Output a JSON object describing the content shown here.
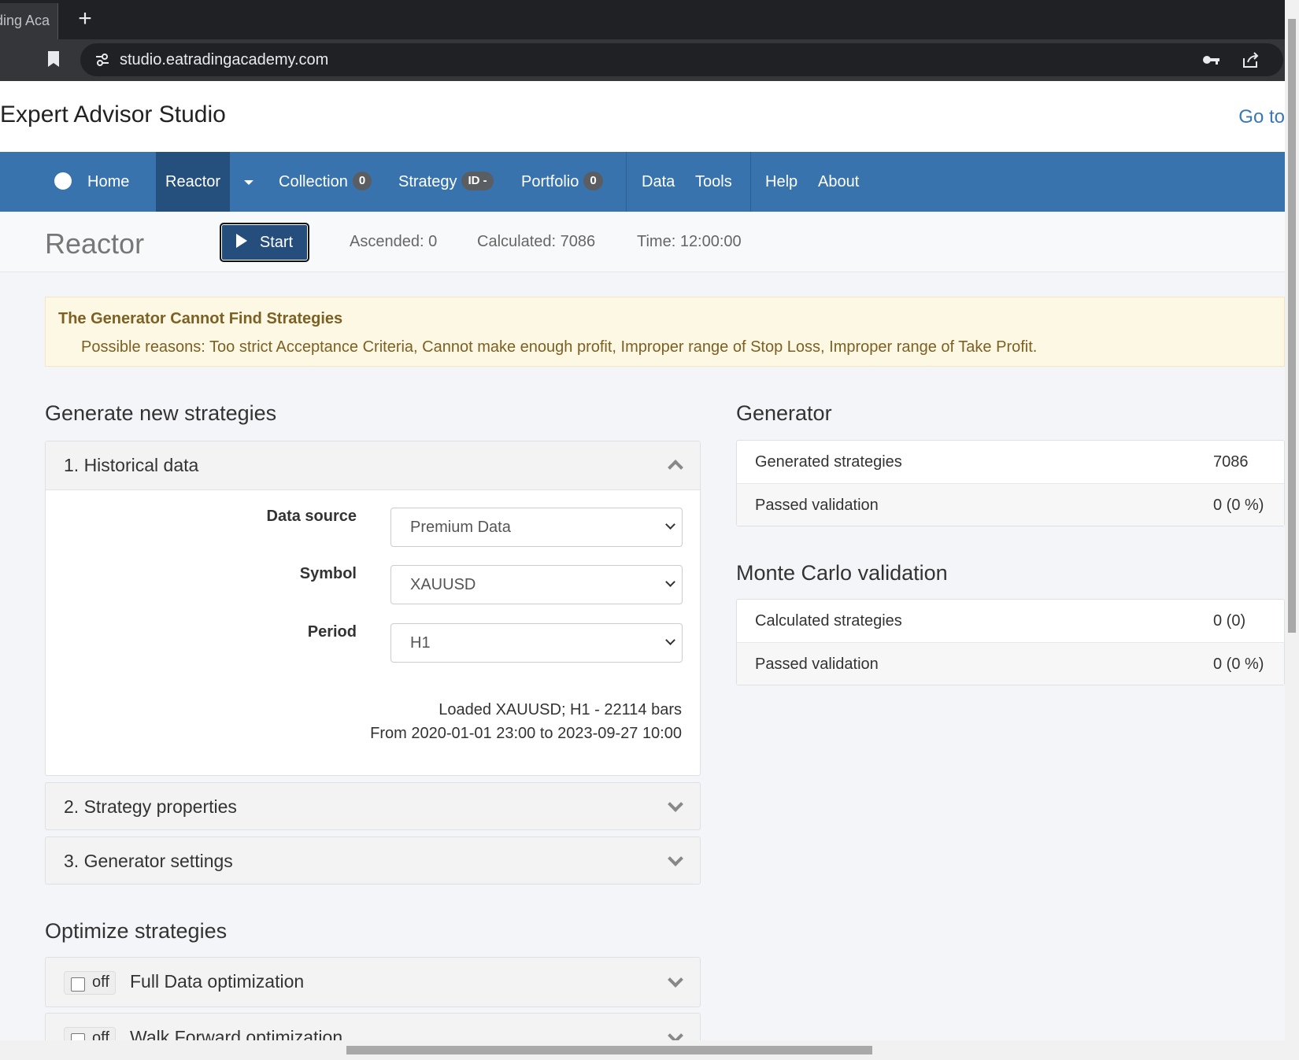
{
  "browser": {
    "tab_title": "ding Aca",
    "url": "studio.eatradingacademy.com"
  },
  "app": {
    "title": "Expert Advisor Studio",
    "goto": "Go to"
  },
  "nav": {
    "home": "Home",
    "reactor": "Reactor",
    "collection": "Collection",
    "collection_count": "0",
    "strategy": "Strategy",
    "strategy_badge": "ID -",
    "portfolio": "Portfolio",
    "portfolio_count": "0",
    "data": "Data",
    "tools": "Tools",
    "help": "Help",
    "about": "About"
  },
  "toolbar": {
    "title": "Reactor",
    "start_label": "Start",
    "ascended": "Ascended: 0",
    "calculated": "Calculated: 7086",
    "time": "Time: 12:00:00"
  },
  "alert": {
    "title": "The Generator Cannot Find Strategies",
    "text": "Possible reasons: Too strict Acceptance Criteria, Cannot make enough profit, Improper range of Stop Loss, Improper range of Take Profit."
  },
  "generate": {
    "heading": "Generate new strategies",
    "historical": {
      "title": "1. Historical data",
      "data_source_label": "Data source",
      "data_source_value": "Premium Data",
      "symbol_label": "Symbol",
      "symbol_value": "XAUUSD",
      "period_label": "Period",
      "period_value": "H1",
      "loaded": "Loaded XAUUSD; H1 - 22114 bars",
      "range": "From 2020-01-01 23:00 to 2023-09-27 10:00"
    },
    "strategy_properties": "2. Strategy properties",
    "generator_settings": "3. Generator settings"
  },
  "optimize": {
    "heading": "Optimize strategies",
    "full_data": {
      "toggle": "off",
      "label": "Full Data optimization"
    },
    "walk_forward": {
      "toggle": "off",
      "label": "Walk Forward optimization"
    }
  },
  "generator": {
    "heading": "Generator",
    "rows": [
      {
        "label": "Generated strategies",
        "value": "7086"
      },
      {
        "label": "Passed validation",
        "value": "0 (0 %)"
      }
    ]
  },
  "monte_carlo": {
    "heading": "Monte Carlo validation",
    "rows": [
      {
        "label": "Calculated strategies",
        "value": "0 (0)"
      },
      {
        "label": "Passed validation",
        "value": "0 (0 %)"
      }
    ]
  }
}
